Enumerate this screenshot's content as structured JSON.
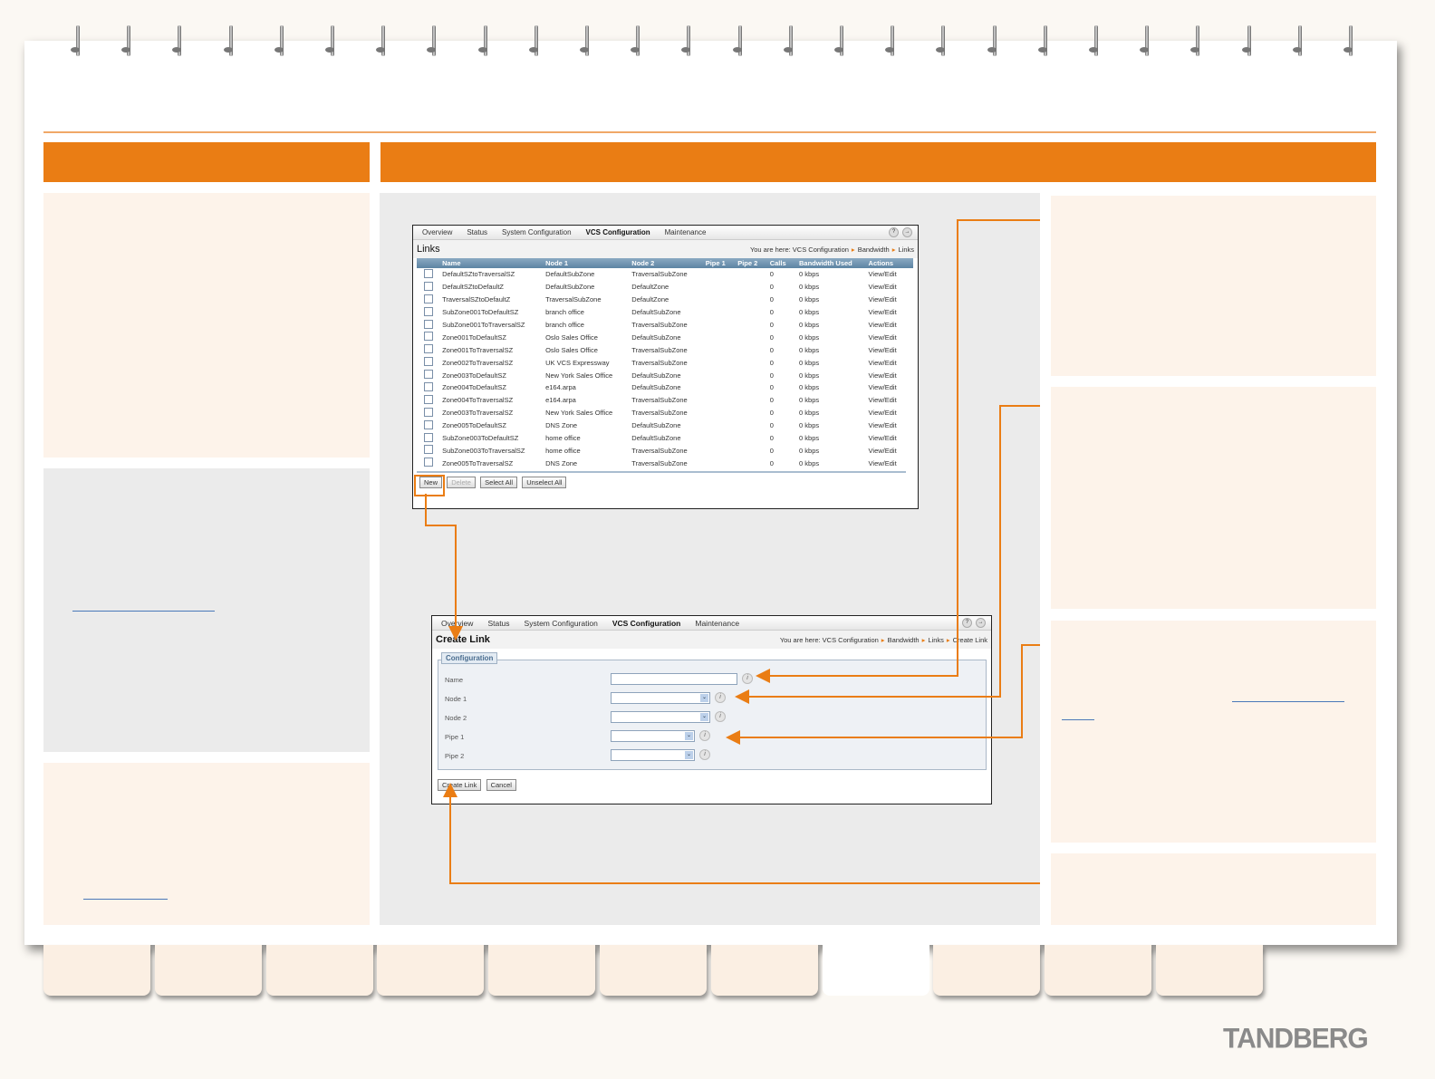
{
  "brand": "TANDBERG",
  "links_screen": {
    "nav": [
      "Overview",
      "Status",
      "System Configuration",
      "VCS Configuration",
      "Maintenance"
    ],
    "active_nav": "VCS Configuration",
    "title": "Links",
    "breadcrumb_prefix": "You are here:",
    "breadcrumb": [
      "VCS Configuration",
      "Bandwidth",
      "Links"
    ],
    "columns": [
      "",
      "Name",
      "Node 1",
      "Node 2",
      "Pipe 1",
      "Pipe 2",
      "Calls",
      "Bandwidth Used",
      "Actions"
    ],
    "rows": [
      [
        "DefaultSZtoTraversalSZ",
        "DefaultSubZone",
        "TraversalSubZone",
        "",
        "",
        "0",
        "0 kbps",
        "View/Edit"
      ],
      [
        "DefaultSZtoDefaultZ",
        "DefaultSubZone",
        "DefaultZone",
        "",
        "",
        "0",
        "0 kbps",
        "View/Edit"
      ],
      [
        "TraversalSZtoDefaultZ",
        "TraversalSubZone",
        "DefaultZone",
        "",
        "",
        "0",
        "0 kbps",
        "View/Edit"
      ],
      [
        "SubZone001ToDefaultSZ",
        "branch office",
        "DefaultSubZone",
        "",
        "",
        "0",
        "0 kbps",
        "View/Edit"
      ],
      [
        "SubZone001ToTraversalSZ",
        "branch office",
        "TraversalSubZone",
        "",
        "",
        "0",
        "0 kbps",
        "View/Edit"
      ],
      [
        "Zone001ToDefaultSZ",
        "Oslo Sales Office",
        "DefaultSubZone",
        "",
        "",
        "0",
        "0 kbps",
        "View/Edit"
      ],
      [
        "Zone001ToTraversalSZ",
        "Oslo Sales Office",
        "TraversalSubZone",
        "",
        "",
        "0",
        "0 kbps",
        "View/Edit"
      ],
      [
        "Zone002ToTraversalSZ",
        "UK VCS Expressway",
        "TraversalSubZone",
        "",
        "",
        "0",
        "0 kbps",
        "View/Edit"
      ],
      [
        "Zone003ToDefaultSZ",
        "New York Sales Office",
        "DefaultSubZone",
        "",
        "",
        "0",
        "0 kbps",
        "View/Edit"
      ],
      [
        "Zone004ToDefaultSZ",
        "e164.arpa",
        "DefaultSubZone",
        "",
        "",
        "0",
        "0 kbps",
        "View/Edit"
      ],
      [
        "Zone004ToTraversalSZ",
        "e164.arpa",
        "TraversalSubZone",
        "",
        "",
        "0",
        "0 kbps",
        "View/Edit"
      ],
      [
        "Zone003ToTraversalSZ",
        "New York Sales Office",
        "TraversalSubZone",
        "",
        "",
        "0",
        "0 kbps",
        "View/Edit"
      ],
      [
        "Zone005ToDefaultSZ",
        "DNS Zone",
        "DefaultSubZone",
        "",
        "",
        "0",
        "0 kbps",
        "View/Edit"
      ],
      [
        "SubZone003ToDefaultSZ",
        "home office",
        "DefaultSubZone",
        "",
        "",
        "0",
        "0 kbps",
        "View/Edit"
      ],
      [
        "SubZone003ToTraversalSZ",
        "home office",
        "TraversalSubZone",
        "",
        "",
        "0",
        "0 kbps",
        "View/Edit"
      ],
      [
        "Zone005ToTraversalSZ",
        "DNS Zone",
        "TraversalSubZone",
        "",
        "",
        "0",
        "0 kbps",
        "View/Edit"
      ]
    ],
    "buttons": {
      "new": "New",
      "delete": "Delete",
      "select_all": "Select All",
      "unselect_all": "Unselect All"
    }
  },
  "create_screen": {
    "nav": [
      "Overview",
      "Status",
      "System Configuration",
      "VCS Configuration",
      "Maintenance"
    ],
    "title": "Create Link",
    "breadcrumb_prefix": "You are here:",
    "breadcrumb": [
      "VCS Configuration",
      "Bandwidth",
      "Links",
      "Create Link"
    ],
    "section": "Configuration",
    "fields": {
      "name": "Name",
      "node1": "Node 1",
      "node2": "Node 2",
      "pipe1": "Pipe 1",
      "pipe2": "Pipe 2"
    },
    "buttons": {
      "create": "Create Link",
      "cancel": "Cancel"
    },
    "help_icon": "?",
    "logout_icon": "→",
    "info_icon": "i",
    "dropdown_icon": "⌄"
  },
  "colors": {
    "accent": "#ea7d14",
    "panel": "#fdf3ea",
    "grey": "#ebebeb",
    "link": "#4a78b8"
  }
}
